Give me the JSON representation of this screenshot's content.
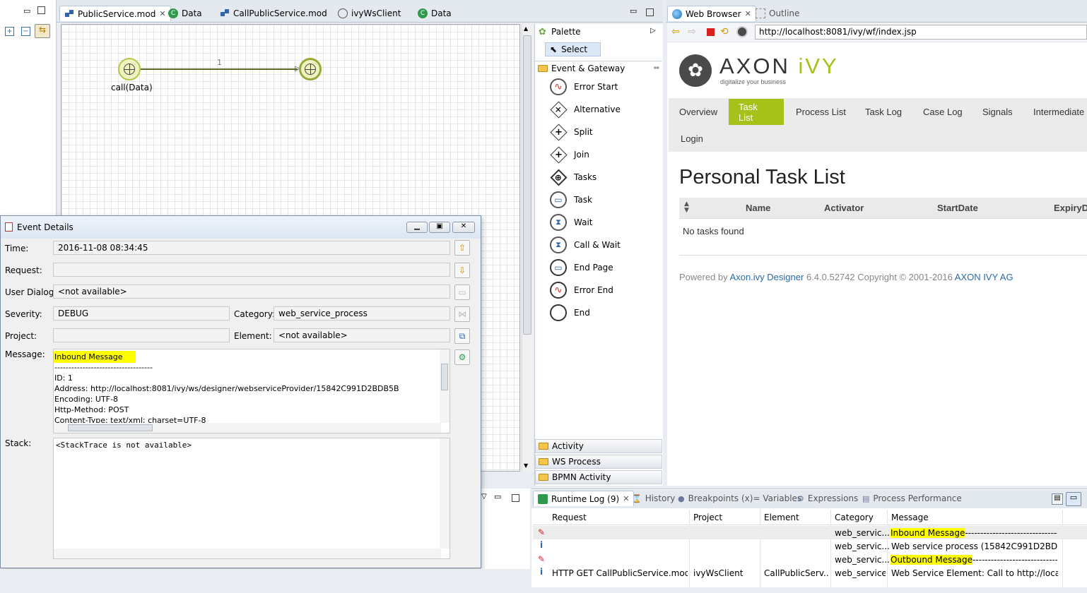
{
  "editor_tabs": [
    "PublicService.mod",
    "Data",
    "CallPublicService.mod",
    "ivyWsClient",
    "Data"
  ],
  "diagram": {
    "start_label": "call(Data)",
    "connector_label": "1"
  },
  "palette": {
    "title": "Palette",
    "select": "Select",
    "event_gateway": "Event & Gateway",
    "items": [
      "Error Start",
      "Alternative",
      "Split",
      "Join",
      "Tasks",
      "Task",
      "Wait",
      "Call & Wait",
      "End Page",
      "Error End",
      "End"
    ],
    "drawers": [
      "Activity",
      "WS Process",
      "BPMN Activity"
    ]
  },
  "browser": {
    "tab": "Web Browser",
    "outline_tab": "Outline",
    "url": "http://localhost:8081/ivy/wf/index.jsp",
    "logo_text": "AXON",
    "logo_accent": "iVY",
    "tagline": "digitalize your business",
    "nav": [
      "Overview",
      "Task List",
      "Process List",
      "Task Log",
      "Case Log",
      "Signals",
      "Intermediate"
    ],
    "login": "Login",
    "heading": "Personal Task List",
    "columns": [
      "Name",
      "Activator",
      "StartDate",
      "ExpiryD"
    ],
    "empty": "No tasks found",
    "footer_pre": "Powered by ",
    "footer_link": "Axon.ivy Designer",
    "footer_mid": " 6.4.0.52742 Copyright © 2001-2016 ",
    "footer_company": "AXON IVY AG",
    "accent": "#a6c11a"
  },
  "event_details": {
    "title": "Event Details",
    "labels": {
      "time": "Time:",
      "request": "Request:",
      "user_dialog": "User Dialog:",
      "severity": "Severity:",
      "category": "Category:",
      "project": "Project:",
      "element": "Element:",
      "message": "Message:",
      "stack": "Stack:"
    },
    "time": "2016-11-08 08:34:45",
    "request": "",
    "user_dialog": "<not available>",
    "severity": "DEBUG",
    "category": "web_service_process",
    "project": "",
    "element": "<not available>",
    "message_lines": [
      "Inbound Message",
      "-----------------------------------",
      "ID: 1",
      "Address: http://localhost:8081/ivy/ws/designer/webserviceProvider/15842C991D2BDB5B",
      "Encoding: UTF-8",
      "Http-Method: POST",
      "Content-Type: text/xml; charset=UTF-8"
    ],
    "stack": "<StackTrace is not available>"
  },
  "bottom_tabs": {
    "runtime_log": "Runtime Log (9)",
    "history": "History",
    "breakpoints": "Breakpoints",
    "variables": "(x)= Variables",
    "expressions": "Expressions",
    "process_performance": "Process Performance"
  },
  "log": {
    "columns": [
      "Request",
      "Project",
      "Element",
      "Category",
      "Message"
    ],
    "rows": [
      {
        "icon": "debug",
        "request": "",
        "project": "",
        "element": "",
        "category": "web_servic...",
        "message_hl": "Inbound Message",
        "message": "-------------------------------..."
      },
      {
        "icon": "info",
        "request": "",
        "project": "",
        "element": "",
        "category": "web_servic...",
        "message_hl": "",
        "message": "Web service process  (15842C991D2BDB5B)..."
      },
      {
        "icon": "debug",
        "request": "",
        "project": "",
        "element": "",
        "category": "web_servic...",
        "message_hl": "Outbound Message",
        "message": "--------------------------------"
      },
      {
        "icon": "info",
        "request": "HTTP GET CallPublicService.mod...",
        "project": "ivyWsClient",
        "element": "CallPublicServ...",
        "category": "web_service",
        "message_hl": "",
        "message": "Web Service Element: Call to http://localho..."
      }
    ]
  }
}
